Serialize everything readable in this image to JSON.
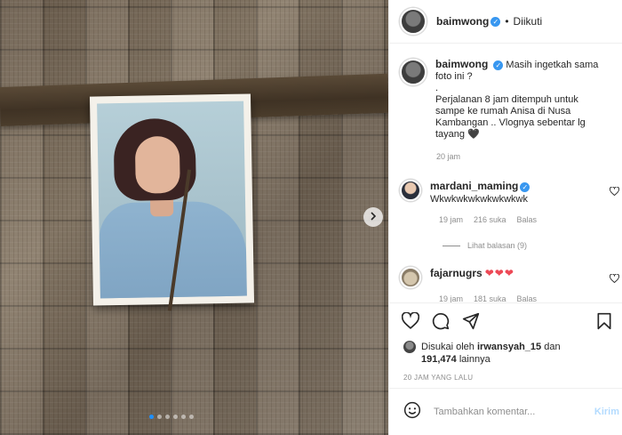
{
  "post": {
    "author": "baimwong",
    "follow_status": "Diikuti",
    "separator": "•",
    "caption_title": "Masih ingetkah sama foto ini ?",
    "caption_dot": ".",
    "caption_body": "Perjalanan 8 jam ditempuh untuk sampe ke rumah Anisa di Nusa Kambangan .. Vlognya sebentar lg tayang",
    "caption_emoji": "🖤",
    "caption_time": "20 jam"
  },
  "comments": [
    {
      "user": "mardani_maming",
      "text": "Wkwkwkwkwkwkwkwk",
      "time": "19 jam",
      "likes": "216 suka",
      "reply": "Balas",
      "view_replies": "Lihat balasan (9)"
    },
    {
      "user": "fajarnugrs",
      "text": "❤❤❤",
      "time": "19 jam",
      "likes": "181 suka",
      "reply": "Balas"
    }
  ],
  "likes": {
    "prefix": "Disukai oleh",
    "user": "irwansyah_15",
    "mid": "dan",
    "count": "191,474",
    "suffix": "lainnya"
  },
  "post_date": "20 JAM YANG LALU",
  "comment_box": {
    "placeholder": "Tambahkan komentar...",
    "post_label": "Kirim"
  },
  "icons": [
    "heart-icon",
    "comment-icon",
    "share-icon",
    "bookmark-icon",
    "emoji-icon",
    "chevron-right-icon",
    "verified-icon",
    "more-icon"
  ],
  "carousel": {
    "slides": 6,
    "active_index": 0
  },
  "colors": {
    "verified": "#3897f0",
    "secondary_text": "#8e8e8e",
    "hearts": "#ed4956",
    "post_button_disabled": "#b3dbff",
    "active_dot": "#1e90ff"
  }
}
